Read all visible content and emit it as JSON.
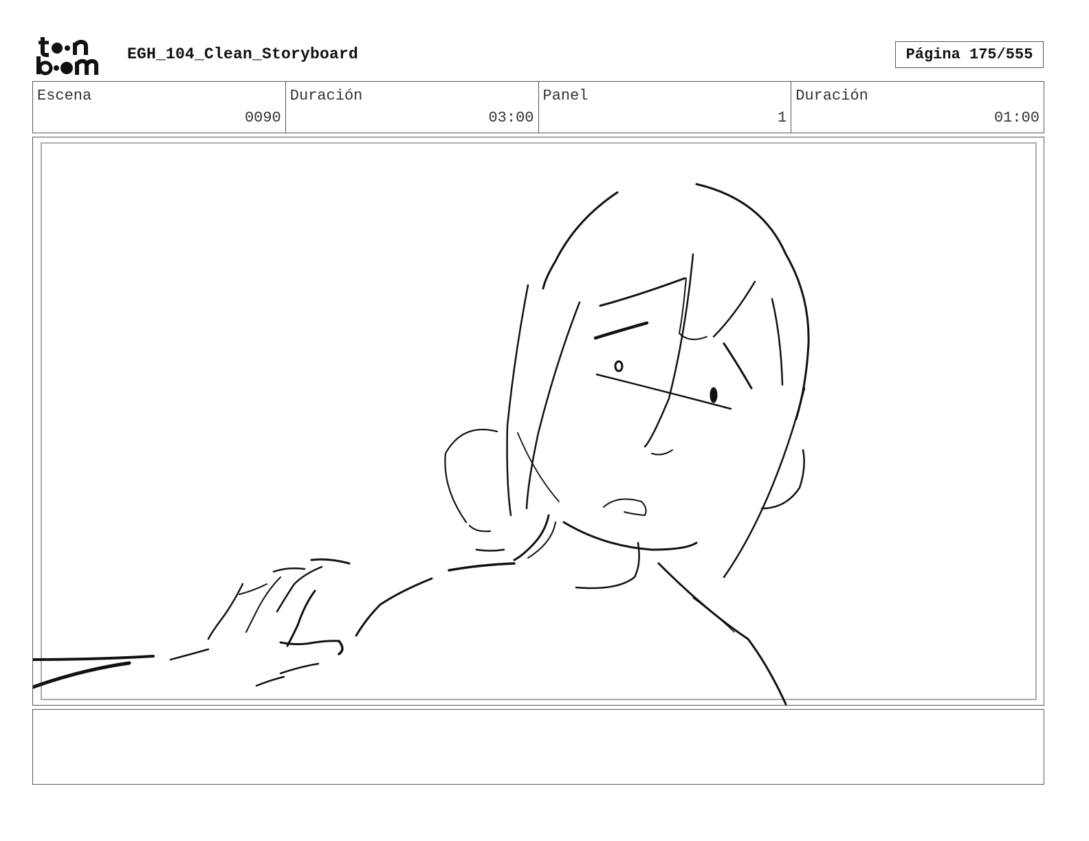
{
  "header": {
    "logo_text": "toon boom",
    "document_title": "EGH_104_Clean_Storyboard",
    "page_label": "Página 175/555"
  },
  "info": {
    "scene_label": "Escena",
    "scene_value": "0090",
    "scene_duration_label": "Duración",
    "scene_duration_value": "03:00",
    "panel_label": "Panel",
    "panel_value": "1",
    "panel_duration_label": "Duración",
    "panel_duration_value": "01:00"
  },
  "notes": {
    "text": ""
  }
}
